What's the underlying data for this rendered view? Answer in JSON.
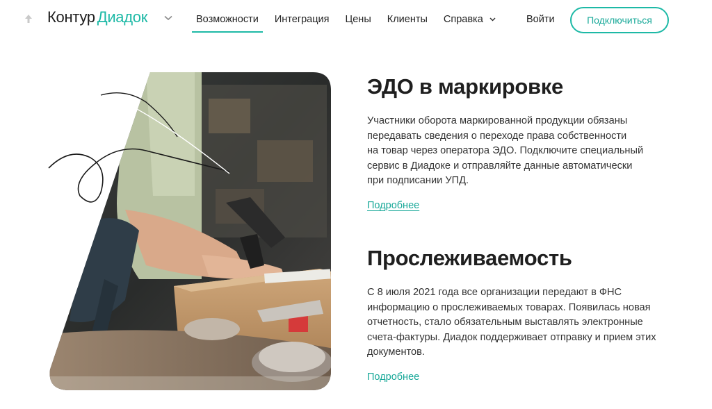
{
  "header": {
    "logo_part1": "Контур",
    "logo_part2": "Диадок",
    "nav": [
      {
        "label": "Возможности",
        "active": true
      },
      {
        "label": "Интеграция"
      },
      {
        "label": "Цены"
      },
      {
        "label": "Клиенты"
      },
      {
        "label": "Справка",
        "has_dropdown": true
      }
    ],
    "login_label": "Войти",
    "connect_label": "Подключиться"
  },
  "sections": [
    {
      "title": "ЭДО в маркировке",
      "lines": [
        "Участники оборота маркированной продукции обязаны",
        "передавать сведения о переходе права собственности",
        "на товар через оператора ЭДО. Подключите специальный",
        "сервис в Диадоке и отправляйте данные автоматически",
        "при подписании УПД."
      ],
      "link": "Подробнее"
    },
    {
      "title": "Прослеживаемость",
      "lines": [
        "С 8 июля 2021 года все организации передают в ФНС",
        "информацию о прослеживаемых товарах. Появилась новая",
        "отчетность, стало обязательным выставлять электронные",
        "счета-фактуры. Диадок поддерживает отправку и прием этих",
        "документов."
      ],
      "link": "Подробнее"
    }
  ],
  "colors": {
    "accent": "#1db9a6",
    "text": "#1f1f1f"
  },
  "icons": {
    "back": "arrow-up-icon",
    "logo_menu": "chevron-down-icon",
    "nav_dropdown": "chevron-down-icon"
  }
}
